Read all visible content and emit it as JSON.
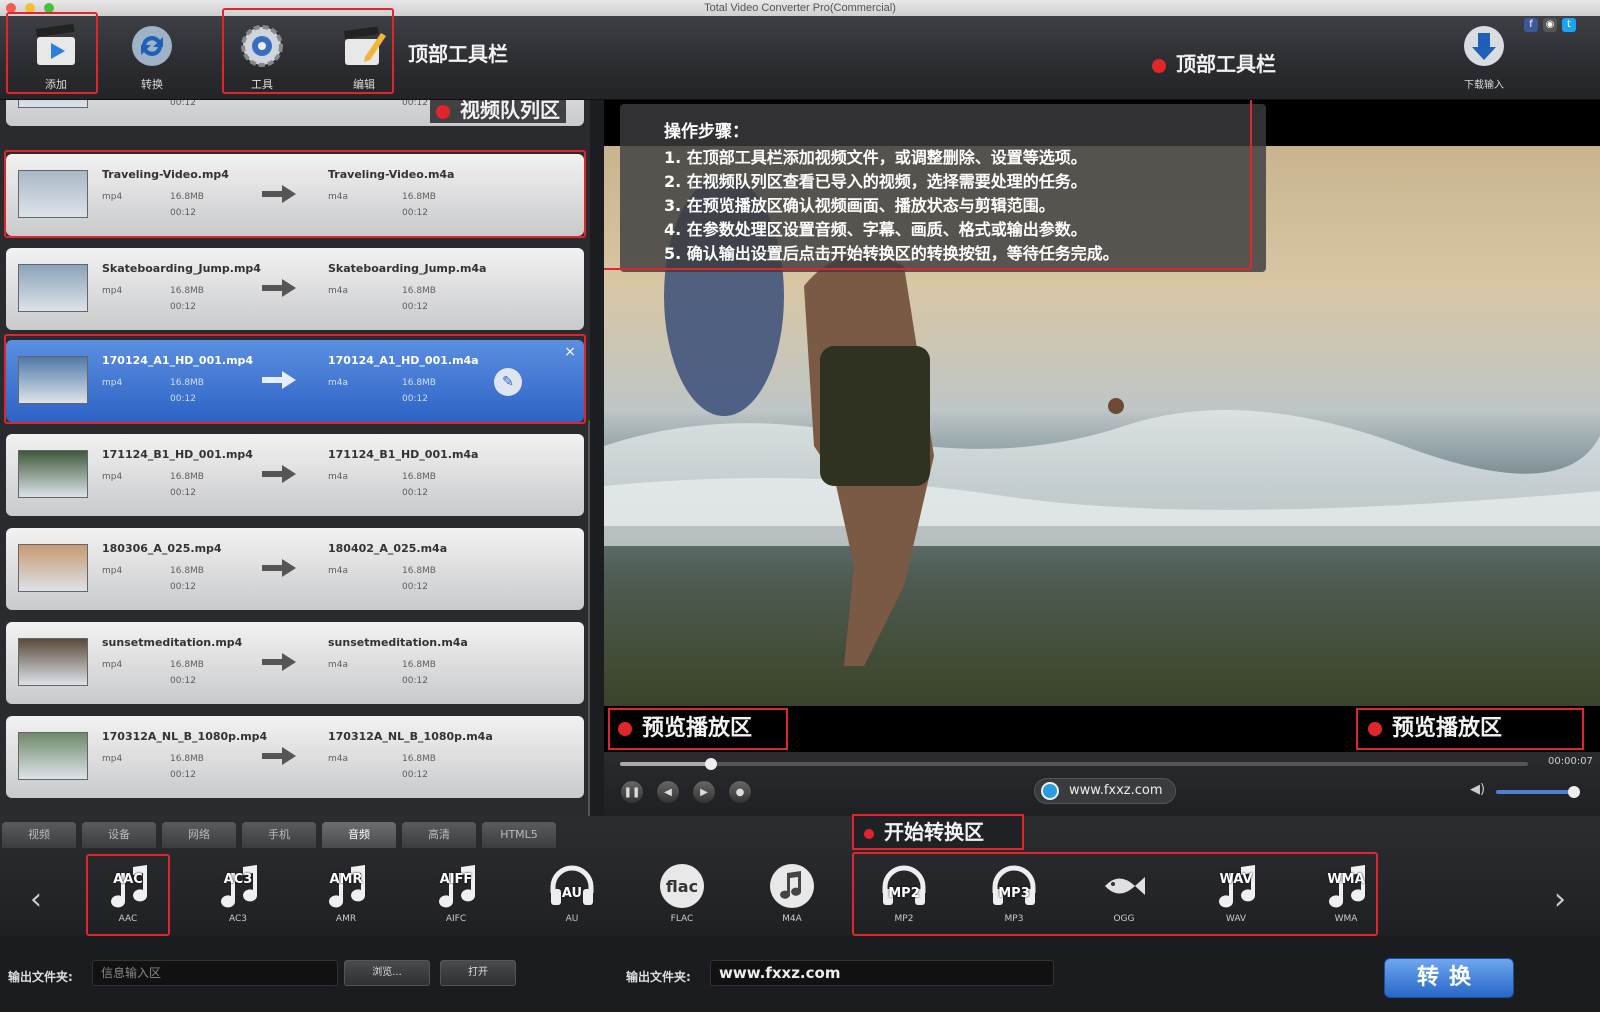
{
  "window": {
    "title": "Total Video Converter Pro(Commercial)"
  },
  "toolbar": {
    "buttons": [
      {
        "label": "添加"
      },
      {
        "label": "转换"
      },
      {
        "label": "工具"
      },
      {
        "label": "编辑"
      }
    ],
    "annotation_left": "顶部工具栏",
    "annotation_right": "顶部工具栏",
    "download_label": "下载输入",
    "social": [
      "f",
      "◉",
      "t"
    ]
  },
  "queue": {
    "annotation": "视频队列区",
    "rows": [
      {
        "source": "",
        "target": ""
      },
      {
        "source": "Traveling-Video.mp4",
        "target": "Traveling-Video.m4a"
      },
      {
        "source": "Skateboarding_Jump.mp4",
        "target": "Skateboarding_Jump.m4a"
      },
      {
        "source": "170124_A1_HD_001.mp4",
        "target": "170124_A1_HD_001.m4a",
        "selected": true
      },
      {
        "source": "171124_B1_HD_001.mp4",
        "target": "171124_B1_HD_001.m4a"
      },
      {
        "source": "180306_A_025.mp4",
        "target": "180402_A_025.m4a"
      },
      {
        "source": "sunsetmeditation.mp4",
        "target": "sunsetmeditation.m4a"
      },
      {
        "source": "170312A_NL_B_1080p.mp4",
        "target": "170312A_NL_B_1080p.m4a"
      }
    ],
    "meta": {
      "fmt_in": "mp4",
      "fmt_out": "m4a",
      "size": "16.8MB",
      "dur": "00:12"
    }
  },
  "preview": {
    "steps_title": "操作步骤：",
    "steps": [
      "1. 在顶部工具栏添加视频文件，或调整删除、设置等选项。",
      "2. 在视频队列区查看已导入的视频，选择需要处理的任务。",
      "3. 在预览播放区确认视频画面、播放状态与剪辑范围。",
      "4. 在参数处理区设置音频、字幕、画质、格式或输出参数。",
      "5. 确认输出设置后点击开始转换区的转换按钮，等待任务完成。"
    ],
    "annotation_left": "预览播放区",
    "annotation_right": "预览播放区",
    "time": "00:00:07",
    "url": "www.fxxz.com",
    "seek_fraction": 0.1,
    "volume_fraction": 0.95
  },
  "formats": {
    "tabs": [
      "视频",
      "设备",
      "网络",
      "手机",
      "音频",
      "高清",
      "HTML5"
    ],
    "active_tab": 4,
    "annotation": "开始转换区",
    "items": [
      {
        "icon": "note",
        "top": "AAC",
        "label": "AAC"
      },
      {
        "icon": "note",
        "top": "AC3",
        "label": "AC3"
      },
      {
        "icon": "note",
        "top": "AMR",
        "label": "AMR"
      },
      {
        "icon": "note",
        "top": "AIFF",
        "label": "AIFC"
      },
      {
        "icon": "headphones",
        "top": "AU",
        "label": "AU"
      },
      {
        "icon": "flac",
        "top": "flac",
        "label": "FLAC"
      },
      {
        "icon": "circle-note",
        "top": "",
        "label": "M4A"
      },
      {
        "icon": "headphones",
        "top": "MP2",
        "label": "MP2"
      },
      {
        "icon": "headphones",
        "top": "MP3",
        "label": "MP3"
      },
      {
        "icon": "fish",
        "top": "",
        "label": "OGG"
      },
      {
        "icon": "note",
        "top": "WAV",
        "label": "WAV"
      },
      {
        "icon": "note",
        "top": "WMA",
        "label": "WMA"
      }
    ]
  },
  "bottom": {
    "output_label": "输出文件夹:",
    "input_placeholder": "信息输入区",
    "browse": "浏览...",
    "open": "打开",
    "output_label2": "输出文件夹:",
    "output_value": "www.fxxz.com",
    "convert": "转换"
  },
  "colors": {
    "accent": "#2d63c6",
    "annotation": "#e0262b"
  }
}
